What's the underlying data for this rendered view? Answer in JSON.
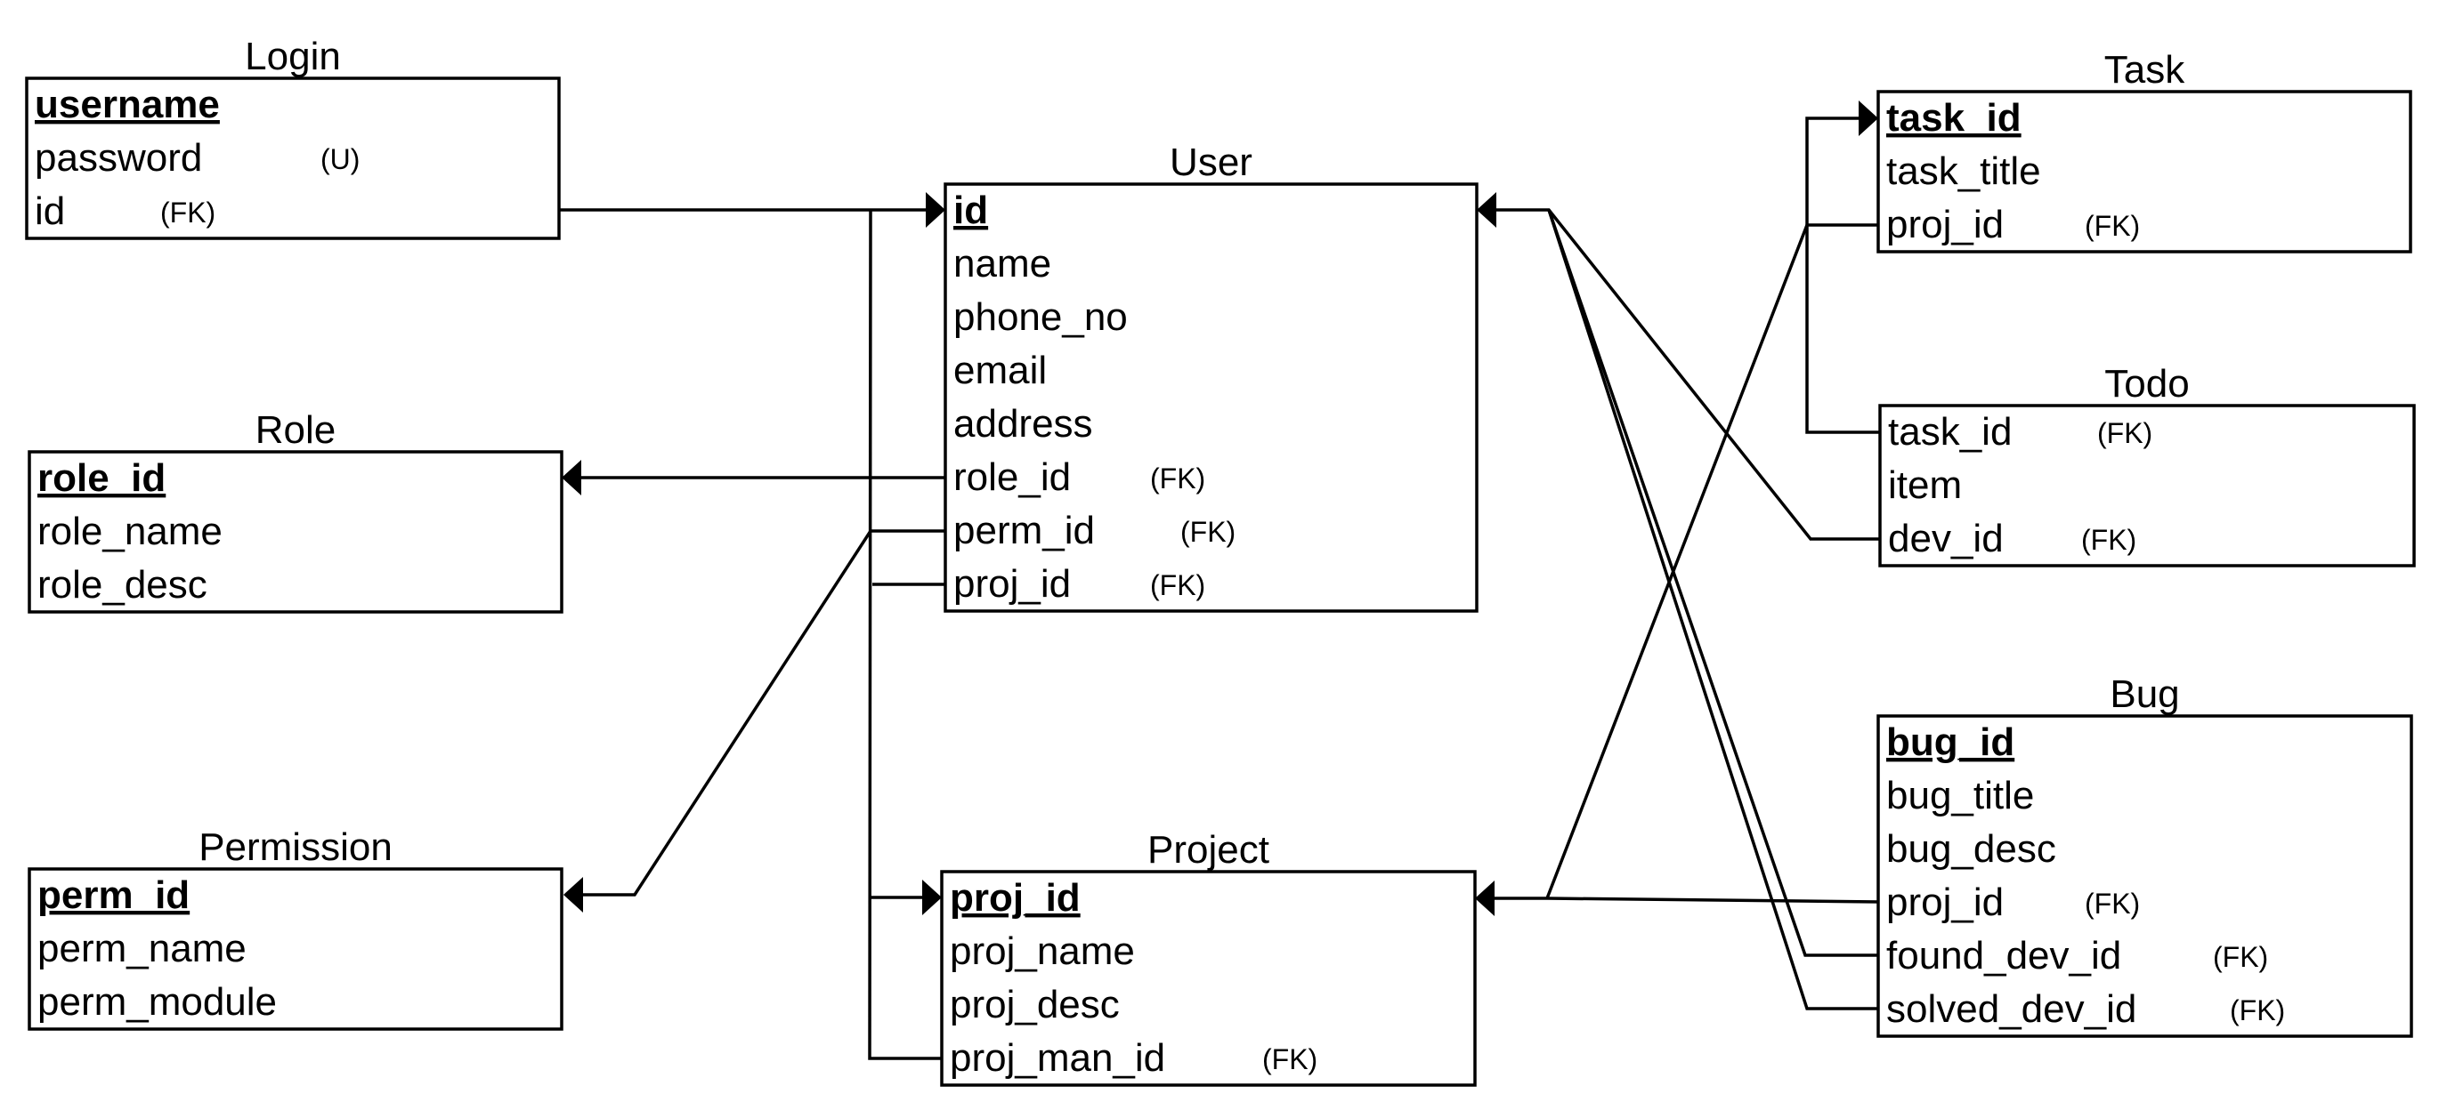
{
  "entities": {
    "login": {
      "name": "Login",
      "fields": [
        {
          "text": "username",
          "pk": true,
          "tag": ""
        },
        {
          "text": "password",
          "pk": false,
          "tag": "(U)"
        },
        {
          "text": "id",
          "pk": false,
          "tag": "(FK)"
        }
      ]
    },
    "role": {
      "name": "Role",
      "fields": [
        {
          "text": "role_id",
          "pk": true,
          "tag": ""
        },
        {
          "text": "role_name",
          "pk": false,
          "tag": ""
        },
        {
          "text": "role_desc",
          "pk": false,
          "tag": ""
        }
      ]
    },
    "permission": {
      "name": "Permission",
      "fields": [
        {
          "text": "perm_id",
          "pk": true,
          "tag": ""
        },
        {
          "text": "perm_name",
          "pk": false,
          "tag": ""
        },
        {
          "text": "perm_module",
          "pk": false,
          "tag": ""
        }
      ]
    },
    "user": {
      "name": "User",
      "fields": [
        {
          "text": "id",
          "pk": true,
          "tag": ""
        },
        {
          "text": "name",
          "pk": false,
          "tag": ""
        },
        {
          "text": "phone_no",
          "pk": false,
          "tag": ""
        },
        {
          "text": "email",
          "pk": false,
          "tag": ""
        },
        {
          "text": "address",
          "pk": false,
          "tag": ""
        },
        {
          "text": "role_id",
          "pk": false,
          "tag": "(FK)"
        },
        {
          "text": "perm_id",
          "pk": false,
          "tag": "(FK)"
        },
        {
          "text": "proj_id",
          "pk": false,
          "tag": "(FK)"
        }
      ]
    },
    "project": {
      "name": "Project",
      "fields": [
        {
          "text": "proj_id",
          "pk": true,
          "tag": ""
        },
        {
          "text": "proj_name",
          "pk": false,
          "tag": ""
        },
        {
          "text": "proj_desc",
          "pk": false,
          "tag": ""
        },
        {
          "text": "proj_man_id",
          "pk": false,
          "tag": "(FK)"
        }
      ]
    },
    "task": {
      "name": "Task",
      "fields": [
        {
          "text": "task_id",
          "pk": true,
          "tag": ""
        },
        {
          "text": "task_title",
          "pk": false,
          "tag": ""
        },
        {
          "text": "proj_id",
          "pk": false,
          "tag": "(FK)"
        }
      ]
    },
    "todo": {
      "name": "Todo",
      "fields": [
        {
          "text": "task_id",
          "pk": false,
          "tag": "(FK)"
        },
        {
          "text": "item",
          "pk": false,
          "tag": ""
        },
        {
          "text": "dev_id",
          "pk": false,
          "tag": "(FK)"
        }
      ]
    },
    "bug": {
      "name": "Bug",
      "fields": [
        {
          "text": "bug_id",
          "pk": true,
          "tag": ""
        },
        {
          "text": "bug_title",
          "pk": false,
          "tag": ""
        },
        {
          "text": "bug_desc",
          "pk": false,
          "tag": ""
        },
        {
          "text": "proj_id",
          "pk": false,
          "tag": "(FK)"
        },
        {
          "text": "found_dev_id",
          "pk": false,
          "tag": "(FK)"
        },
        {
          "text": "solved_dev_id",
          "pk": false,
          "tag": "(FK)"
        }
      ]
    }
  },
  "relationships": [
    {
      "from": "login.id",
      "to": "user.id"
    },
    {
      "from": "user.role_id",
      "to": "role.role_id"
    },
    {
      "from": "user.perm_id",
      "to": "permission.perm_id"
    },
    {
      "from": "user.proj_id",
      "to": "project.proj_id"
    },
    {
      "from": "project.proj_man_id",
      "to": "user.id"
    },
    {
      "from": "todo.dev_id",
      "to": "user.id"
    },
    {
      "from": "bug.found_dev_id",
      "to": "user.id"
    },
    {
      "from": "bug.solved_dev_id",
      "to": "user.id"
    },
    {
      "from": "task.proj_id",
      "to": "project.proj_id"
    },
    {
      "from": "bug.proj_id",
      "to": "project.proj_id"
    },
    {
      "from": "todo.task_id",
      "to": "task.task_id"
    }
  ]
}
